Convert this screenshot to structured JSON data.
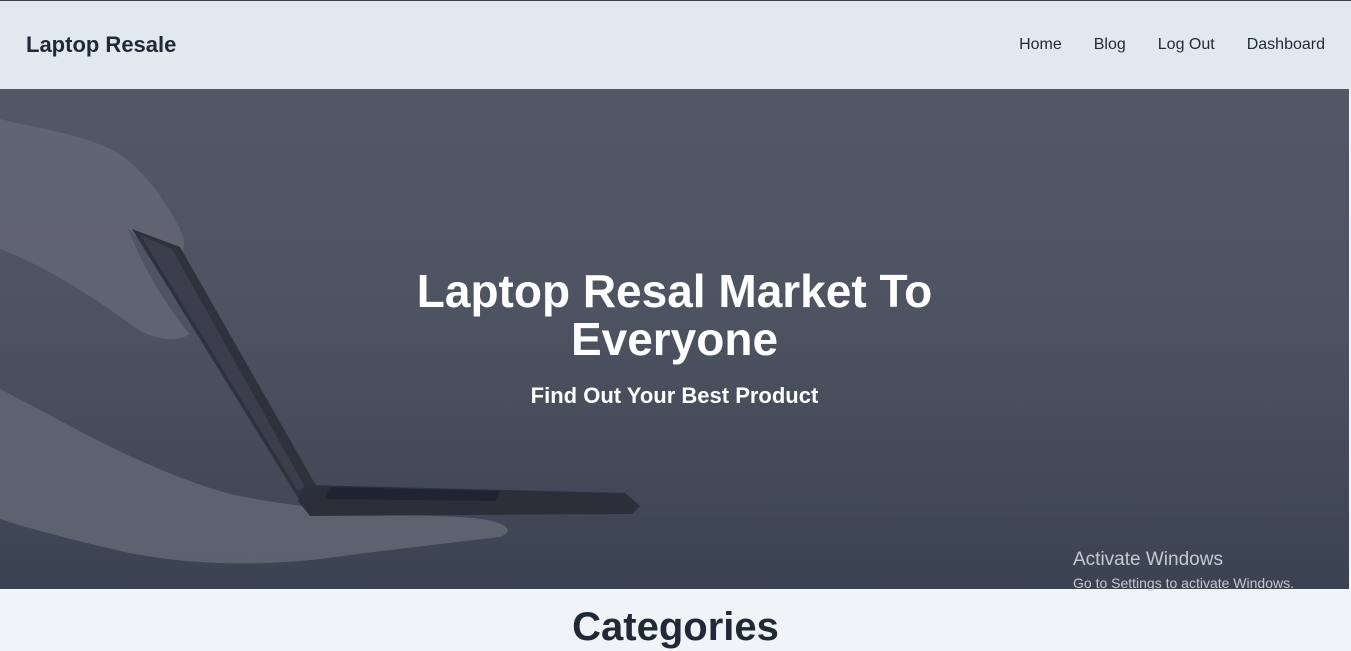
{
  "navbar": {
    "brand": "Laptop Resale",
    "links": [
      "Home",
      "Blog",
      "Log Out",
      "Dashboard"
    ]
  },
  "hero": {
    "title": "Laptop Resal Market To Everyone",
    "subtitle": "Find Out Your Best Product"
  },
  "section": {
    "heading": "Categories"
  },
  "os_watermark": {
    "title": "Activate Windows",
    "subtitle": "Go to Settings to activate Windows."
  },
  "colors": {
    "navbar_bg": "#e2e8f0",
    "text_dark": "#1f2937",
    "hero_overlay": "#4d5361",
    "page_bg": "#f0f3f8"
  }
}
